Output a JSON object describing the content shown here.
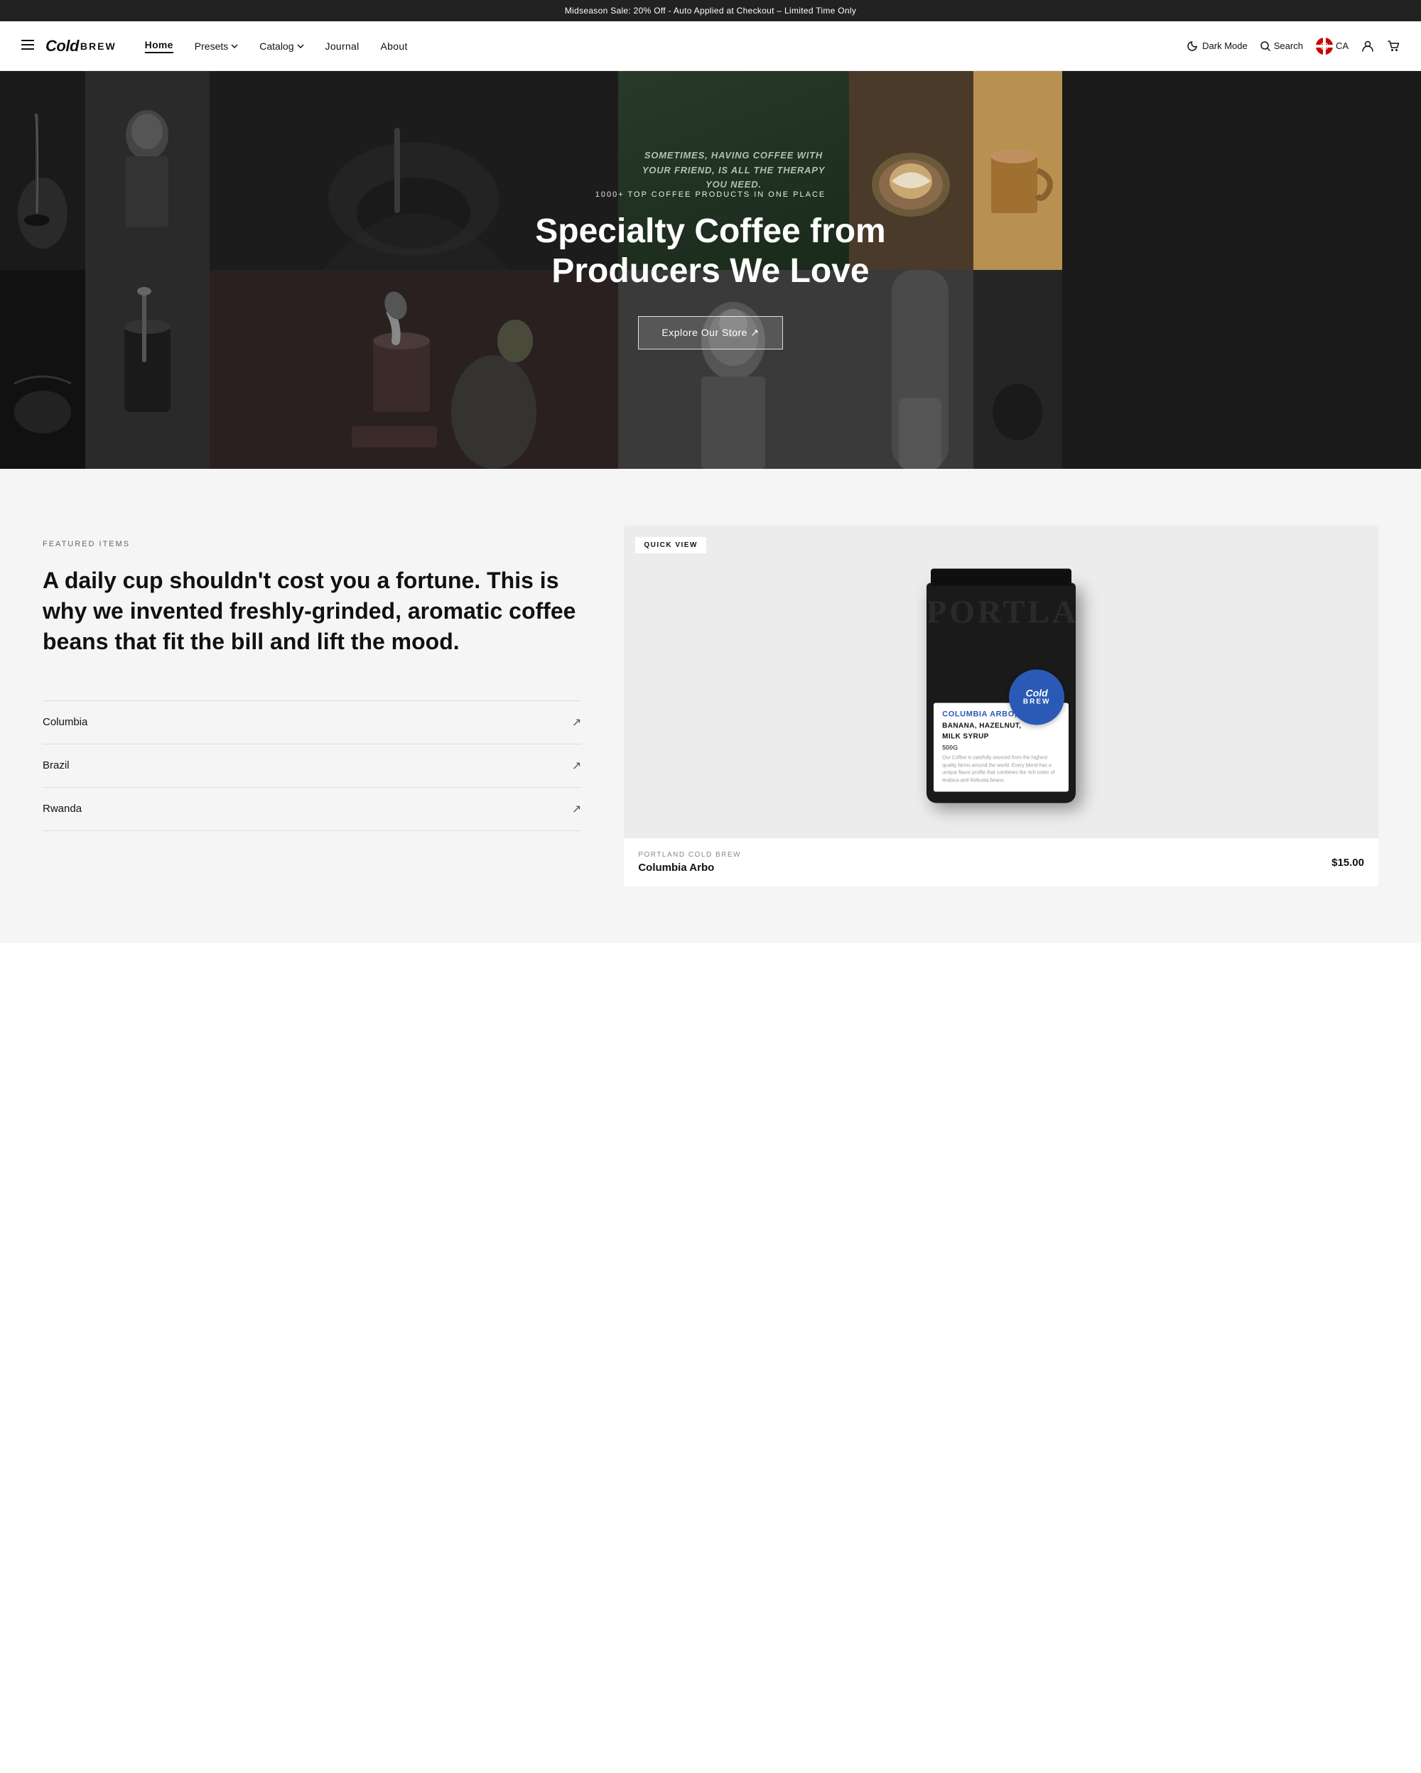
{
  "announcement": {
    "text": "Midseason Sale: 20% Off - Auto Applied at Checkout – Limited Time Only"
  },
  "header": {
    "logo_script": "Cold",
    "logo_bold": "BREW",
    "nav": {
      "items": [
        {
          "label": "Home",
          "active": true
        },
        {
          "label": "Presets",
          "has_dropdown": true
        },
        {
          "label": "Catalog",
          "has_dropdown": true
        },
        {
          "label": "Journal",
          "has_dropdown": false
        },
        {
          "label": "About",
          "has_dropdown": false
        }
      ]
    },
    "dark_mode_label": "Dark Mode",
    "search_label": "Search",
    "country_code": "CA"
  },
  "hero": {
    "subtitle": "1000+ Top Coffee Products In One Place",
    "title": "Specialty Coffee from Producers We Love",
    "cta_label": "Explore Our Store ↗",
    "quote": "Sometimes, having coffee with your friend, is all the therapy you need."
  },
  "featured": {
    "section_label": "Featured Items",
    "title": "A daily cup shouldn't cost you a fortune. This is why we invented freshly-grinded, aromatic coffee beans that fit the bill and lift the mood.",
    "list_items": [
      {
        "label": "Columbia"
      },
      {
        "label": "Brazil"
      },
      {
        "label": "Rwanda"
      }
    ]
  },
  "product": {
    "quick_view_label": "Quick View",
    "brand_name": "Portland Cold Brew",
    "product_name": "Columbia Arbo",
    "bag_brand_text_line1": "COLUMBIA ARBO,",
    "bag_brand_text_line2": "BANANA, HAZELNUT,",
    "bag_brand_text_line3": "MILK SYRUP",
    "bag_weight": "500G",
    "bag_logo_line1": "Cold",
    "bag_logo_line2": "BREW",
    "bag_watermark": "PORTLAND",
    "price": "$15.00",
    "bag_small_text": "Our Coffee is carefully sourced from the highest quality farms around the world. Every blend has a unique flavor profile that combines the rich notes of Arabica and Robusta beans."
  }
}
